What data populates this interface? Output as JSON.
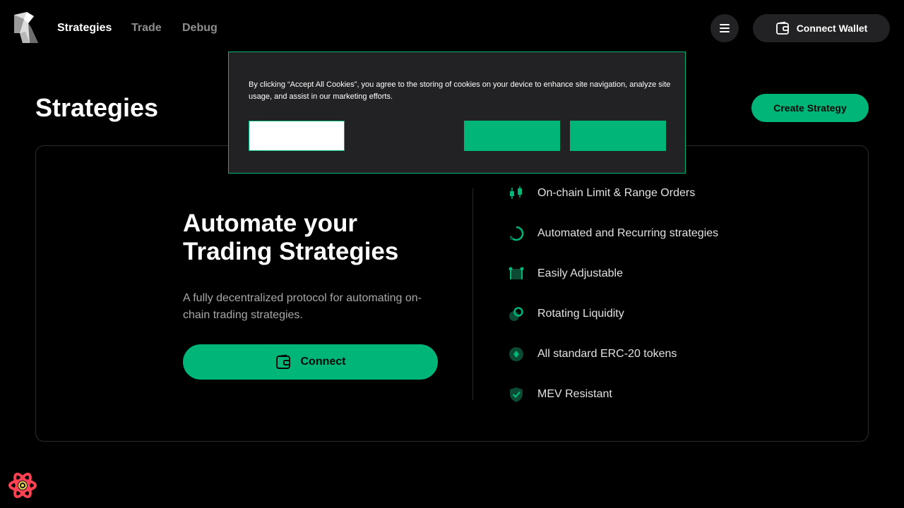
{
  "header": {
    "nav": [
      {
        "label": "Strategies"
      },
      {
        "label": "Trade"
      },
      {
        "label": "Debug"
      }
    ],
    "connect_wallet_label": "Connect Wallet"
  },
  "page": {
    "title": "Strategies",
    "create_strategy_label": "Create Strategy"
  },
  "hero": {
    "title_line1": "Automate your",
    "title_line2": "Trading Strategies",
    "description": "A fully decentralized protocol for automating on-chain trading strategies.",
    "connect_label": "Connect"
  },
  "features": [
    {
      "label": "On-chain Limit & Range Orders",
      "icon": "candlestick-icon"
    },
    {
      "label": "Automated and Recurring strategies",
      "icon": "recurring-icon"
    },
    {
      "label": "Easily Adjustable",
      "icon": "adjust-icon"
    },
    {
      "label": "Rotating Liquidity",
      "icon": "rotate-liquidity-icon"
    },
    {
      "label": "All standard ERC-20 tokens",
      "icon": "token-icon"
    },
    {
      "label": "MEV Resistant",
      "icon": "shield-check-icon"
    }
  ],
  "cookie_banner": {
    "text": "By clicking “Accept All Cookies”, you agree to the storing of cookies on your device to enhance site navigation, analyze site usage, and assist in our marketing efforts.",
    "settings_label": "",
    "reject_label": "",
    "accept_label": ""
  },
  "colors": {
    "background": "#000000",
    "accent": "#00b578",
    "surface": "#222224",
    "muted_text": "#8e8e8e"
  }
}
